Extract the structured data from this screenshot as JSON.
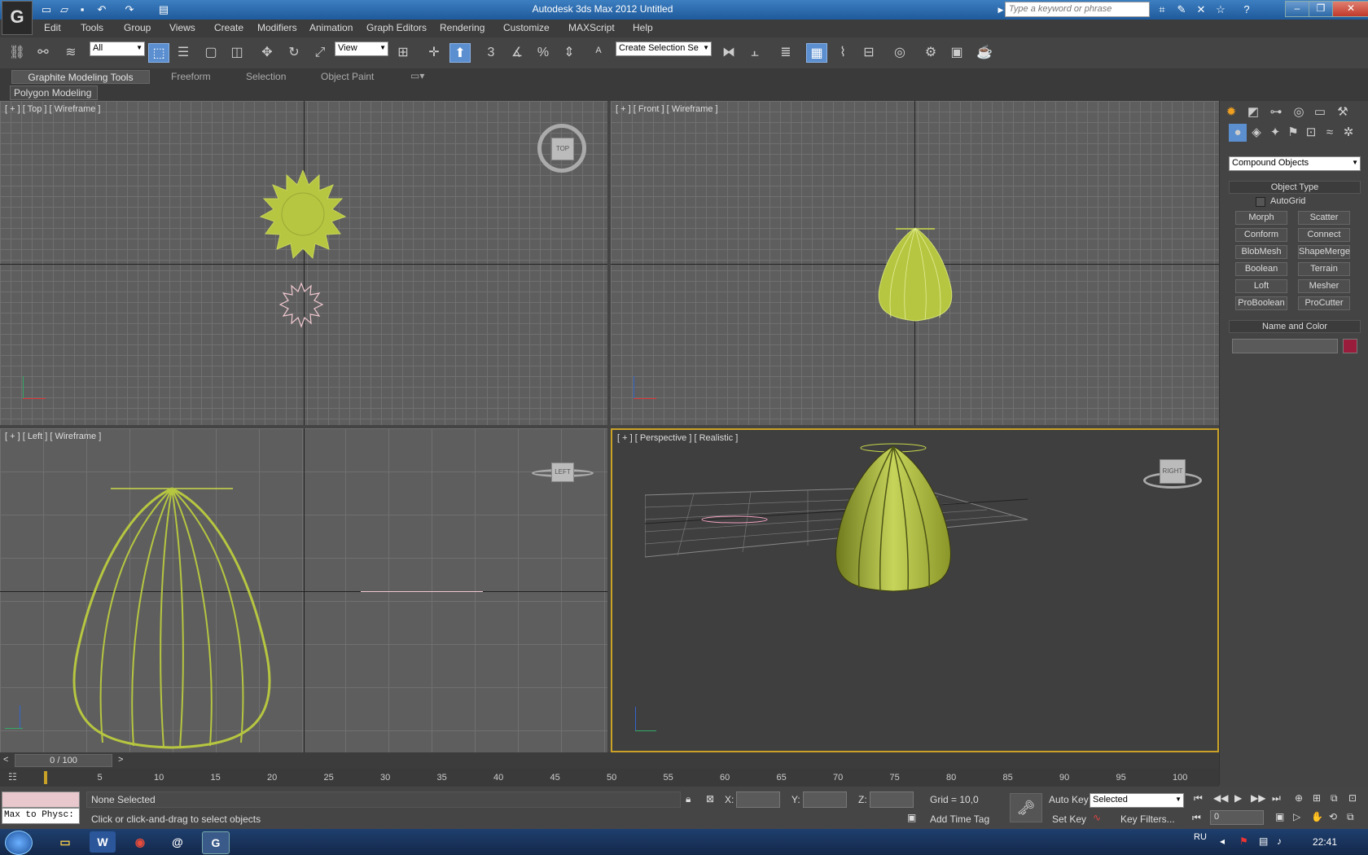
{
  "title_bar": {
    "app_logo": "G",
    "title": "Autodesk 3ds Max  2012      Untitled",
    "search_placeholder": "Type a keyword or phrase"
  },
  "menu": [
    "Edit",
    "Tools",
    "Group",
    "Views",
    "Create",
    "Modifiers",
    "Animation",
    "Graph Editors",
    "Rendering",
    "Customize",
    "MAXScript",
    "Help"
  ],
  "toolbar": {
    "selection_filter": "All",
    "ref_coord": "View",
    "snap_label": "3",
    "named_selection": "Create Selection Se"
  },
  "ribbon": {
    "tabs": [
      "Graphite Modeling Tools",
      "Freeform",
      "Selection",
      "Object Paint"
    ],
    "sub_button": "Polygon Modeling"
  },
  "viewports": {
    "top": {
      "label": "[ + ] [ Top ] [ Wireframe ]",
      "cube": "TOP"
    },
    "front": {
      "label": "[ + ] [ Front ] [ Wireframe ]"
    },
    "left": {
      "label": "[ + ] [ Left ] [ Wireframe ]",
      "cube": "LEFT"
    },
    "perspective": {
      "label": "[ + ] [ Perspective ] [ Realistic ]",
      "cube": "RIGHT"
    }
  },
  "command_panel": {
    "category": "Compound Objects",
    "object_type_title": "Object Type",
    "autogrid": "AutoGrid",
    "buttons": [
      "Morph",
      "Scatter",
      "Conform",
      "Connect",
      "BlobMesh",
      "ShapeMerge",
      "Boolean",
      "Terrain",
      "Loft",
      "Mesher",
      "ProBoolean",
      "ProCutter"
    ],
    "name_color_title": "Name and Color",
    "object_color": "#9a1c3c"
  },
  "time_slider": {
    "frame": "0 / 100",
    "ticks": [
      "5",
      "10",
      "15",
      "20",
      "25",
      "30",
      "35",
      "40",
      "45",
      "50",
      "55",
      "60",
      "65",
      "70",
      "75",
      "80",
      "85",
      "90",
      "95",
      "100"
    ]
  },
  "status": {
    "maxscript": "Max to Physc:",
    "selection": "None Selected",
    "prompt": "Click or click-and-drag to select objects",
    "x_label": "X:",
    "y_label": "Y:",
    "z_label": "Z:",
    "grid": "Grid = 10,0",
    "add_time_tag": "Add Time Tag",
    "auto_key": "Auto Key",
    "set_key": "Set Key",
    "key_mode": "Selected",
    "key_filters": "Key Filters...",
    "current_frame": "0"
  },
  "taskbar": {
    "lang": "RU",
    "clock": "22:41"
  },
  "colors": {
    "accent_blue": "#5b8fd0",
    "object_green": "#b6c640",
    "active_viewport": "#c9a227"
  }
}
